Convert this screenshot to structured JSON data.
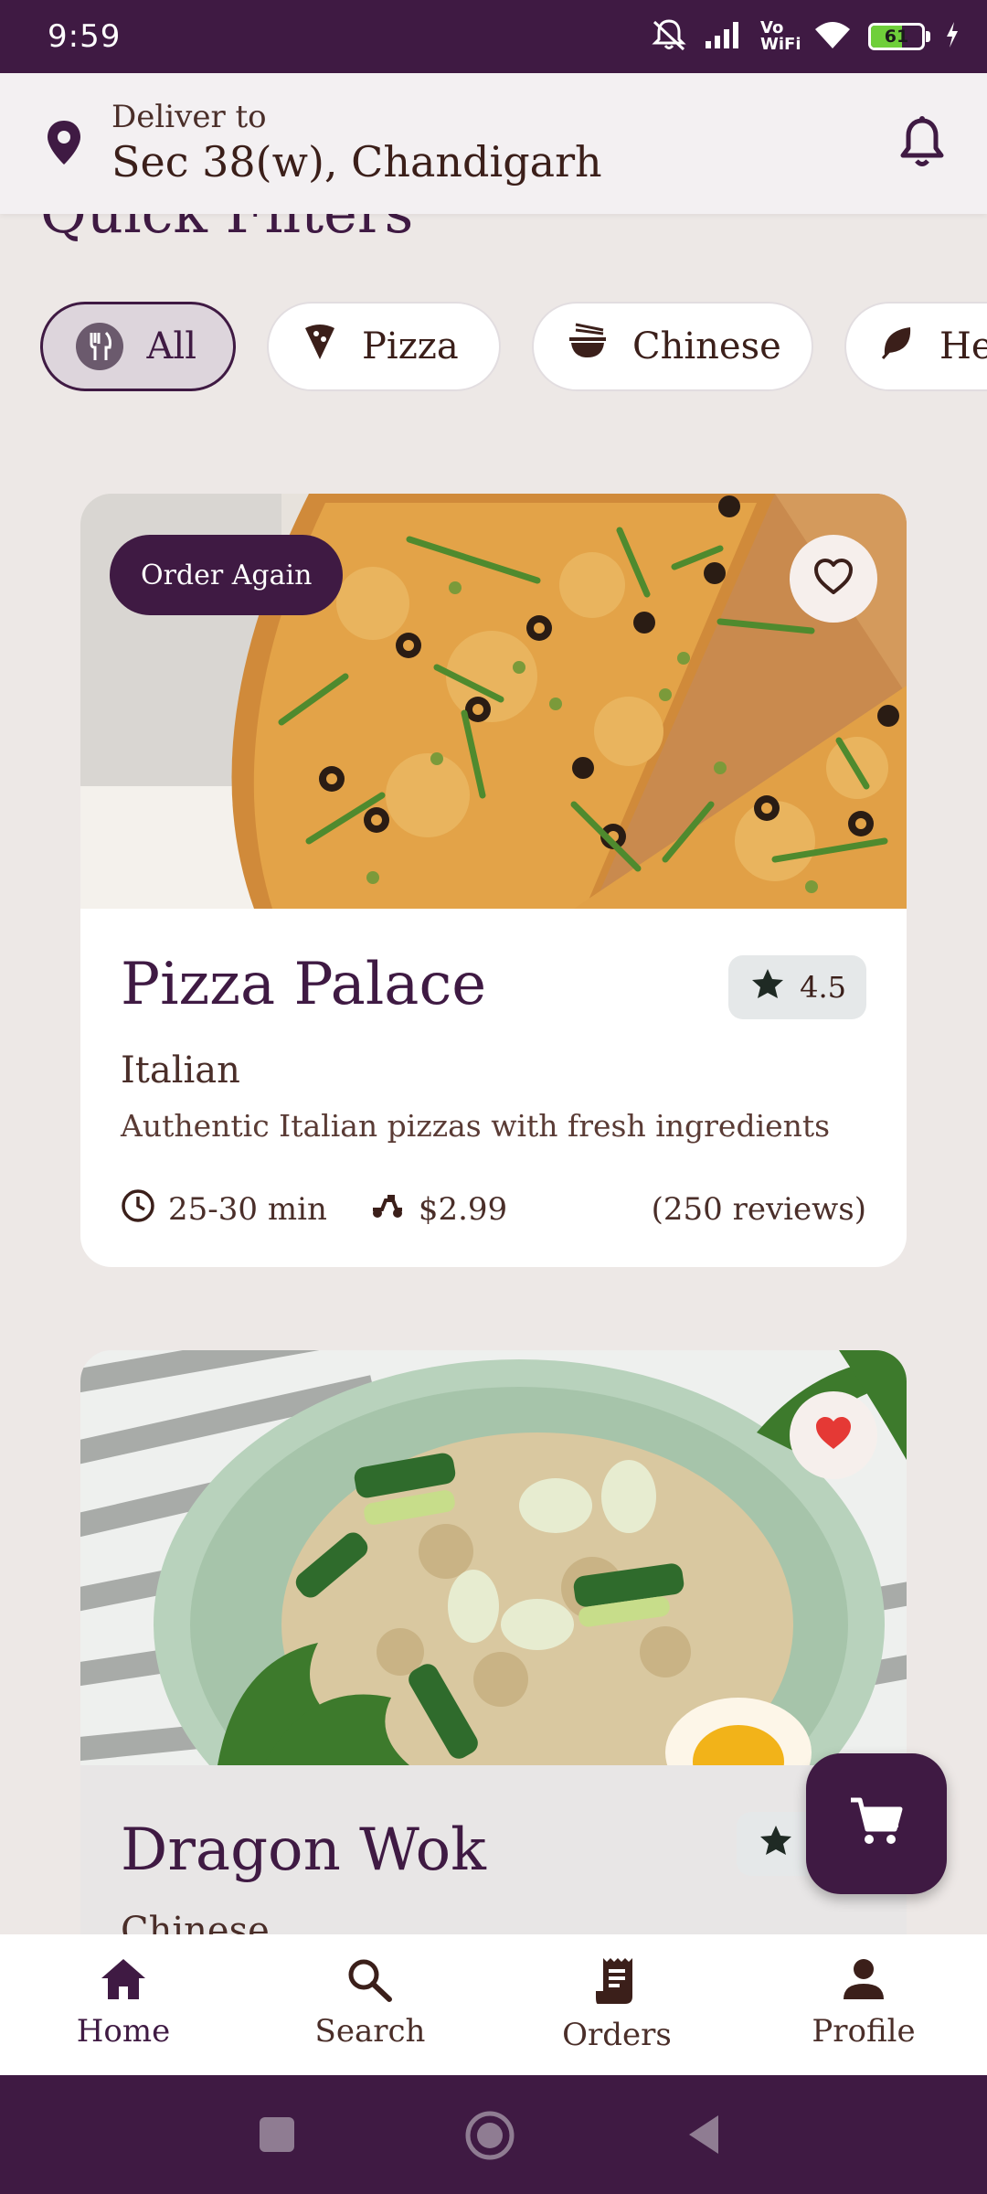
{
  "status_bar": {
    "time": "9:59",
    "network_label": "Vo WiFi",
    "battery_level": "61",
    "battery_fraction": 0.61
  },
  "header": {
    "deliver_label": "Deliver to",
    "address": "Sec 38(w), Chandigarh",
    "icons": [
      "location-pin-icon",
      "bell-icon"
    ]
  },
  "quick_filters": {
    "title": "Quick Filters",
    "chips": [
      {
        "label": "All",
        "icon": "fork-knife-icon",
        "active": true
      },
      {
        "label": "Pizza",
        "icon": "pizza-slice-icon",
        "active": false
      },
      {
        "label": "Chinese",
        "icon": "noodle-bowl-icon",
        "active": false
      },
      {
        "label": "He",
        "icon": "leaf-icon",
        "active": false
      }
    ]
  },
  "restaurants": [
    {
      "badge": "Order Again",
      "name": "Pizza Palace",
      "rating": "4.5",
      "cuisine": "Italian",
      "description": "Authentic Italian pizzas with fresh ingredients",
      "delivery_time": "25-30 min",
      "delivery_fee": "$2.99",
      "reviews": "(250 reviews)",
      "favorite": false
    },
    {
      "name": "Dragon Wok",
      "cuisine": "Chinese",
      "favorite": true
    }
  ],
  "bottom_nav": [
    {
      "label": "Home",
      "icon": "home-icon",
      "active": true
    },
    {
      "label": "Search",
      "icon": "search-icon",
      "active": false
    },
    {
      "label": "Orders",
      "icon": "receipt-icon",
      "active": false
    },
    {
      "label": "Profile",
      "icon": "person-icon",
      "active": false
    }
  ],
  "colors": {
    "primary": "#3f1a43",
    "background": "#ede8e6",
    "favorite_red": "#e53935",
    "text_brown": "#3b1f1a"
  }
}
